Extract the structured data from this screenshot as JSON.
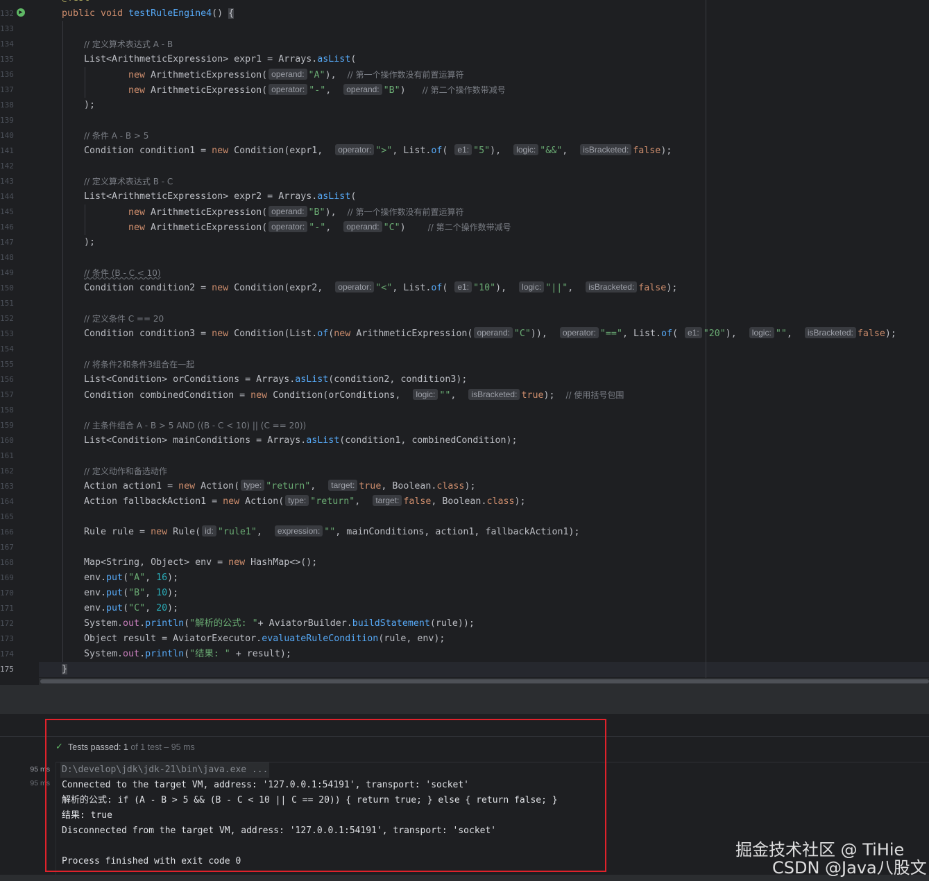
{
  "editor": {
    "line_numbers": [
      "132",
      "133",
      "134",
      "135",
      "136",
      "137",
      "138",
      "139",
      "140",
      "141",
      "142",
      "143",
      "144",
      "145",
      "146",
      "147",
      "148",
      "149",
      "150",
      "151",
      "152",
      "153",
      "154",
      "155",
      "156",
      "157",
      "158",
      "159",
      "160",
      "161",
      "162",
      "163",
      "164",
      "165",
      "166",
      "167",
      "168",
      "169",
      "170",
      "171",
      "172",
      "173",
      "174",
      "175"
    ],
    "top_partial": "@Test",
    "lines": {
      "l132": [
        "public void ",
        "testRuleEngine4",
        "() ",
        "{"
      ],
      "l134": "// 定义算术表达式 A - B",
      "l135": [
        "List<ArithmeticExpression> expr1 = ",
        "Arrays",
        ".",
        "asList",
        "("
      ],
      "l136": [
        "new ",
        "ArithmeticExpression(",
        "operand:",
        "\"A\"",
        "),  ",
        "// 第一个操作数没有前置运算符"
      ],
      "l137": [
        "new ",
        "ArithmeticExpression(",
        "operator:",
        "\"-\"",
        ",  ",
        "operand:",
        "\"B\"",
        ")   ",
        "// 第二个操作数带减号"
      ],
      "l138": ");",
      "l140": "// 条件 A - B > 5",
      "l141": [
        "Condition condition1 = ",
        "new ",
        "Condition(expr1,  ",
        "operator:",
        "\">\"",
        ", ",
        "List",
        ".",
        "of",
        "( ",
        "e1:",
        "\"5\"",
        "),  ",
        "logic:",
        "\"&&\"",
        ",  ",
        "isBracketed:",
        "false",
        ");"
      ],
      "l143": "// 定义算术表达式 B - C",
      "l144": [
        "List<ArithmeticExpression> expr2 = ",
        "Arrays",
        ".",
        "asList",
        "("
      ],
      "l145": [
        "new ",
        "ArithmeticExpression(",
        "operand:",
        "\"B\"",
        "),  ",
        "// 第一个操作数没有前置运算符"
      ],
      "l146": [
        "new ",
        "ArithmeticExpression(",
        "operator:",
        "\"-\"",
        ",  ",
        "operand:",
        "\"C\"",
        ")    ",
        "// 第二个操作数带减号"
      ],
      "l147": ");",
      "l149": "// 条件 (B - C < 10)",
      "l150": [
        "Condition condition2 = ",
        "new ",
        "Condition(expr2,  ",
        "operator:",
        "\"<\"",
        ", ",
        "List",
        ".",
        "of",
        "( ",
        "e1:",
        "\"10\"",
        "),  ",
        "logic:",
        "\"||\"",
        ",  ",
        "isBracketed:",
        "false",
        ");"
      ],
      "l152": "// 定义条件 C == 20",
      "l153": [
        "Condition condition3 = ",
        "new ",
        "Condition(",
        "List",
        ".",
        "of",
        "(",
        "new ",
        "ArithmeticExpression(",
        "operand:",
        "\"C\"",
        ")),  ",
        "operator:",
        "\"==\"",
        ", ",
        "List",
        ".",
        "of",
        "( ",
        "e1:",
        "\"20\"",
        "),  ",
        "logic:",
        "\"\"",
        ",  ",
        "isBracketed:",
        "false",
        ");"
      ],
      "l155": "// 将条件2和条件3组合在一起",
      "l156": [
        "List<Condition> orConditions = ",
        "Arrays",
        ".",
        "asList",
        "(condition2, condition3);"
      ],
      "l157": [
        "Condition combinedCondition = ",
        "new ",
        "Condition(orConditions,  ",
        "logic:",
        "\"\"",
        ",  ",
        "isBracketed:",
        "true",
        ");  ",
        "// 使用括号包围"
      ],
      "l159": "// 主条件组合 A - B > 5 AND ((B - C < 10) || (C == 20))",
      "l160": [
        "List<Condition> mainConditions = ",
        "Arrays",
        ".",
        "asList",
        "(condition1, combinedCondition);"
      ],
      "l162": "// 定义动作和备选动作",
      "l163": [
        "Action action1 = ",
        "new ",
        "Action(",
        "type:",
        "\"return\"",
        ",  ",
        "target:",
        "true",
        ", ",
        "Boolean",
        ".",
        "class",
        ");"
      ],
      "l164": [
        "Action fallbackAction1 = ",
        "new ",
        "Action(",
        "type:",
        "\"return\"",
        ",  ",
        "target:",
        "false",
        ", ",
        "Boolean",
        ".",
        "class",
        ");"
      ],
      "l166": [
        "Rule rule = ",
        "new ",
        "Rule(",
        "id:",
        "\"rule1\"",
        ",  ",
        "expression:",
        "\"\"",
        ", mainConditions, action1, fallbackAction1);"
      ],
      "l168": [
        "Map<String, Object> env = ",
        "new ",
        "HashMap<>();"
      ],
      "l169": [
        "env.",
        "put",
        "(",
        "\"A\"",
        ", ",
        "16",
        ");"
      ],
      "l170": [
        "env.",
        "put",
        "(",
        "\"B\"",
        ", ",
        "10",
        ");"
      ],
      "l171": [
        "env.",
        "put",
        "(",
        "\"C\"",
        ", ",
        "20",
        ");"
      ],
      "l172": [
        "System.",
        "out",
        ".",
        "println",
        "(",
        "\"解析的公式: \"",
        "+ AviatorBuilder.",
        "buildStatement",
        "(rule));"
      ],
      "l173": [
        "Object result = AviatorExecutor.",
        "evaluateRuleCondition",
        "(rule, env);"
      ],
      "l174": [
        "System.",
        "out",
        ".",
        "println",
        "(",
        "\"结果: \"",
        " + result);"
      ],
      "l175": "}"
    }
  },
  "test_panel": {
    "status_main": "Tests passed: 1",
    "status_sub": " of 1 test – 95 ms",
    "durations": [
      "95 ms",
      "95 ms"
    ],
    "output": [
      "D:\\develop\\jdk\\jdk-21\\bin\\java.exe ...",
      "Connected to the target VM, address: '127.0.0.1:54191', transport: 'socket'",
      "解析的公式: if (A - B > 5 && (B - C < 10 || C == 20)) { return true; } else { return false; }",
      "结果: true",
      "Disconnected from the target VM, address: '127.0.0.1:54191', transport: 'socket'",
      "",
      "Process finished with exit code 0"
    ]
  },
  "watermark": {
    "line1": "掘金技术社区 @ TiHie",
    "line2": "CSDN @Java八股文"
  },
  "colors": {
    "background": "#1e1f22",
    "keyword": "#cf8e6d",
    "string": "#6aab73",
    "number": "#2aacb8",
    "method": "#56a8f5",
    "field": "#c77dbb",
    "comment": "#7a7e85",
    "pass_green": "#5fb865",
    "highlight_box": "#e0222b"
  }
}
